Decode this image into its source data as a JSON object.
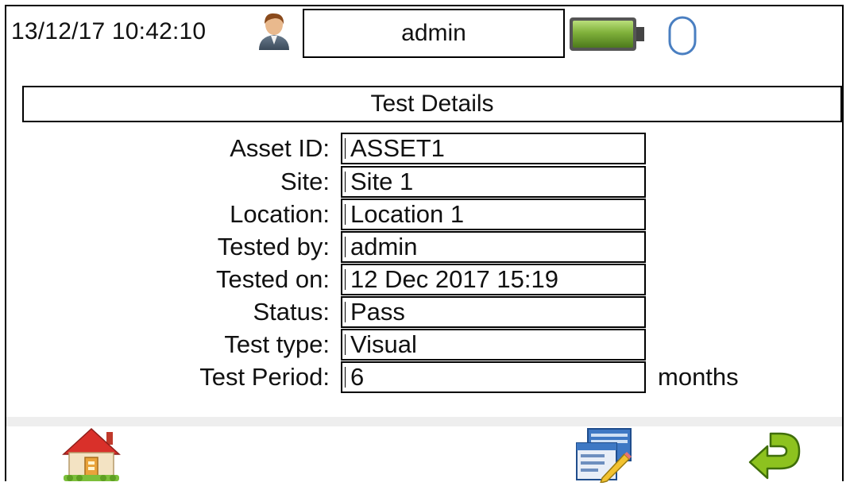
{
  "status_bar": {
    "datetime": "13/12/17 10:42:10",
    "user": "admin",
    "icons": [
      "user-icon",
      "battery-icon",
      "mouse-icon"
    ]
  },
  "title": "Test Details",
  "fields": [
    {
      "label": "Asset ID:",
      "value": "ASSET1"
    },
    {
      "label": "Site:",
      "value": "Site 1"
    },
    {
      "label": "Location:",
      "value": "Location 1"
    },
    {
      "label": "Tested by:",
      "value": "admin"
    },
    {
      "label": "Tested on:",
      "value": "12 Dec 2017 15:19"
    },
    {
      "label": "Status:",
      "value": "Pass"
    },
    {
      "label": "Test type:",
      "value": "Visual"
    },
    {
      "label": "Test Period:",
      "value": "6",
      "unit": "months"
    }
  ],
  "toolbar": {
    "icons": [
      "home-icon",
      "report-icon",
      "back-icon"
    ]
  },
  "colors": {
    "battery": "#7fb03a",
    "back_arrow": "#8dc21f",
    "home_roof": "#d9302a"
  }
}
